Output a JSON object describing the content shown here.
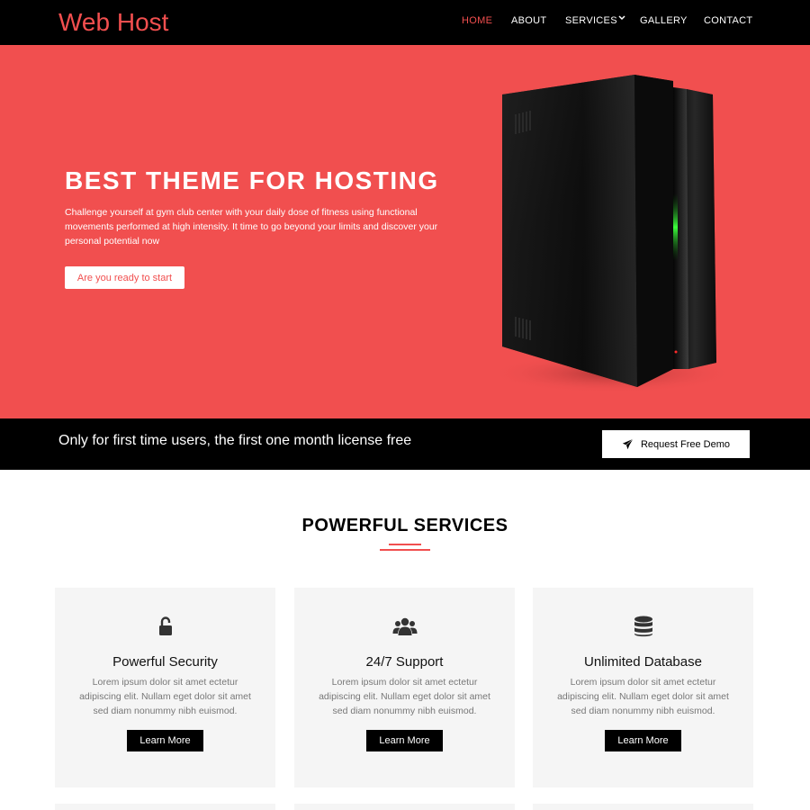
{
  "header": {
    "logo": "Web Host",
    "nav": [
      {
        "label": "HOME",
        "active": true
      },
      {
        "label": "ABOUT",
        "active": false
      },
      {
        "label": "SERVICES",
        "active": false
      },
      {
        "label": "GALLERY",
        "active": false
      },
      {
        "label": "CONTACT",
        "active": false
      }
    ]
  },
  "hero": {
    "title": "BEST THEME FOR HOSTING",
    "text": "Challenge yourself at gym club center with your daily dose of fitness using functional movements performed at high intensity. It time to go beyond your limits and discover your personal potential now",
    "button": "Are you ready to start",
    "image": "server-tower-image"
  },
  "promo": {
    "text": "Only for first time users, the first one month license free",
    "button": "Request Free Demo",
    "button_icon": "paper-plane-icon"
  },
  "services": {
    "title": "POWERFUL SERVICES",
    "cards": [
      {
        "icon": "unlock-icon",
        "title": "Powerful Security",
        "text": "Lorem ipsum dolor sit amet ectetur adipiscing elit. Nullam eget dolor sit amet sed diam nonummy nibh euismod.",
        "button": "Learn More"
      },
      {
        "icon": "users-icon",
        "title": "24/7 Support",
        "text": "Lorem ipsum dolor sit amet ectetur adipiscing elit. Nullam eget dolor sit amet sed diam nonummy nibh euismod.",
        "button": "Learn More"
      },
      {
        "icon": "database-icon",
        "title": "Unlimited Database",
        "text": "Lorem ipsum dolor sit amet ectetur adipiscing elit. Nullam eget dolor sit amet sed diam nonummy nibh euismod.",
        "button": "Learn More"
      }
    ]
  },
  "colors": {
    "accent": "#f14f4f",
    "dark": "#000000",
    "card_bg": "#f5f5f5"
  }
}
